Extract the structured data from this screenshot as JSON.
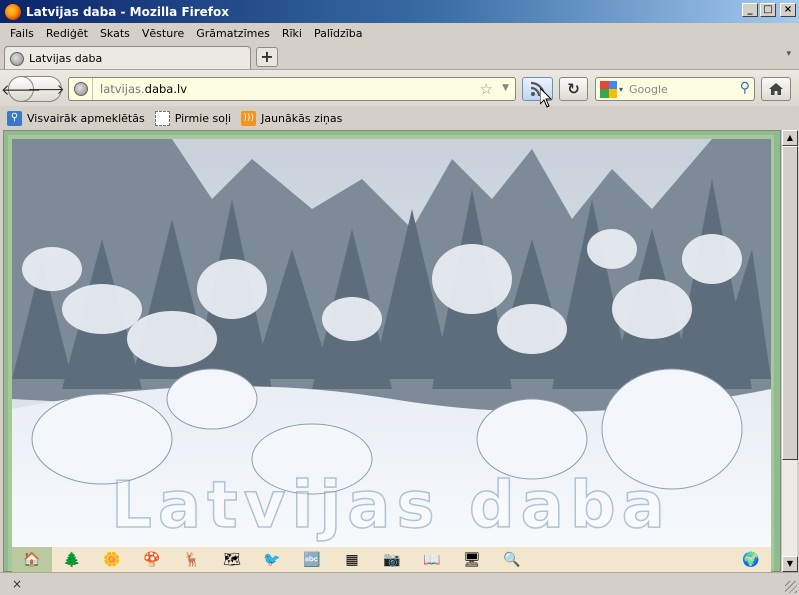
{
  "window": {
    "title": "Latvijas daba - Mozilla Firefox"
  },
  "menu": [
    "Fails",
    "Rediģēt",
    "Skats",
    "Vēsture",
    "Grāmatzīmes",
    "Rīki",
    "Palīdzība"
  ],
  "tab": {
    "label": "Latvijas daba"
  },
  "url": {
    "prefix": "latvijas.",
    "host": "daba.lv"
  },
  "search": {
    "placeholder": "Google"
  },
  "bookmarks": [
    "Visvairāk apmeklētās",
    "Pirmie soļi",
    "Jaunākās ziņas"
  ],
  "banner": {
    "watermark": "Latvijas daba"
  },
  "icons": [
    "site-home-icon",
    "landscape-icon",
    "flower-plant-icon",
    "mushroom-icon",
    "deer-insect-icon",
    "map-icon",
    "bird-icon",
    "alphabet-list-icon",
    "grid-table-icon",
    "camera-icon",
    "book-icon",
    "computer-info-icon",
    "magnifier-icon",
    "earth-globe-icon"
  ],
  "colors": {
    "titlebar": "#0a246a",
    "url_bg": "#fdfde1",
    "icon_row_bg": "#f3e6cf",
    "page_frame": "#a8c89a"
  }
}
